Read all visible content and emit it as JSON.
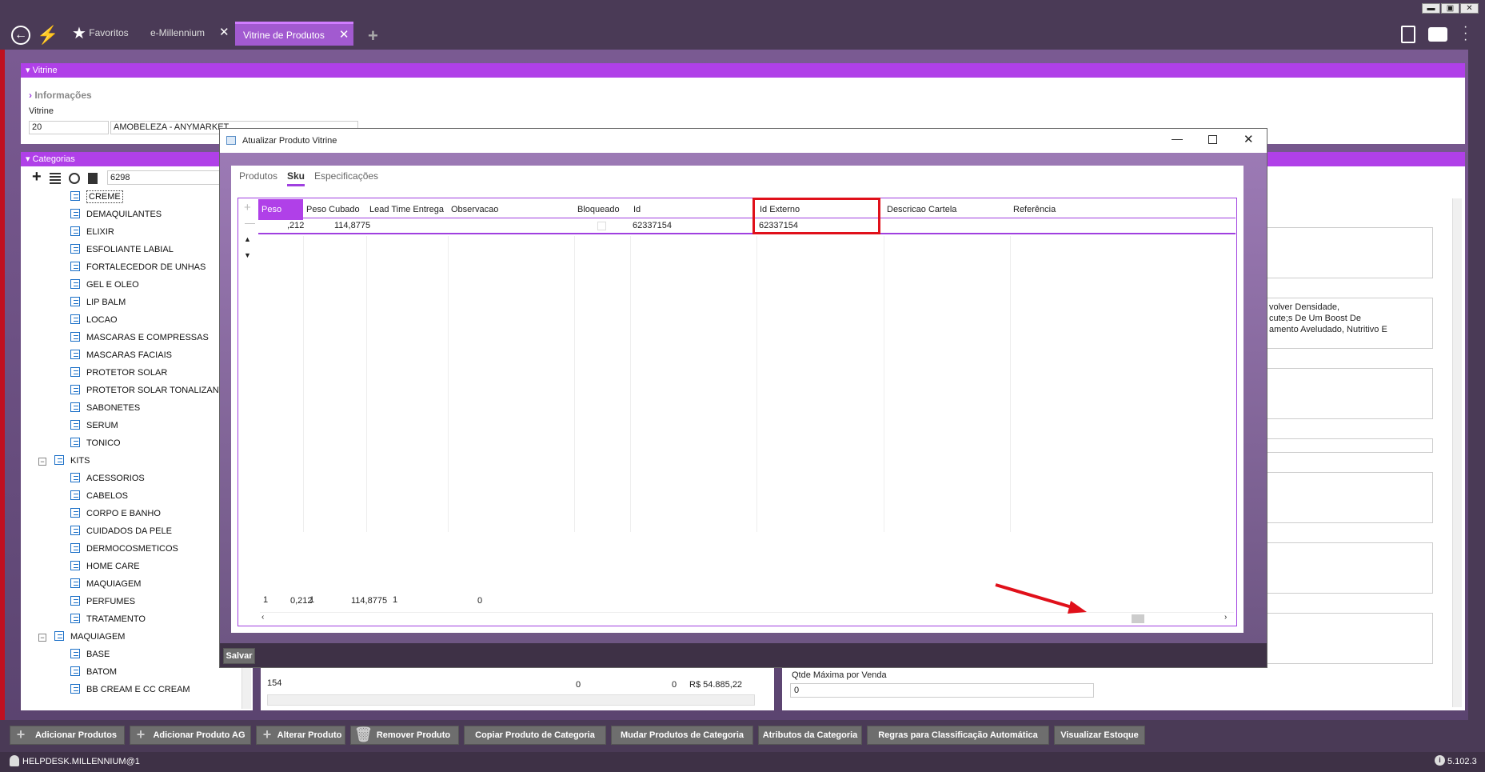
{
  "topbar": {
    "tabs": [
      {
        "label": "Favoritos"
      },
      {
        "label": "e-Millennium"
      },
      {
        "label": "Vitrine de Produtos"
      }
    ],
    "close_glyph": "✕",
    "add_glyph": "+",
    "win_min": "▬",
    "win_max": "▣",
    "win_close": "✕"
  },
  "vitrine": {
    "section_title": "Vitrine",
    "info_label": "Informações",
    "field_label": "Vitrine",
    "code": "20",
    "name": "AMOBELEZA - ANYMARKET"
  },
  "categorias": {
    "section_title": "Categorias",
    "search_value": "6298",
    "items": [
      {
        "label": "CREME",
        "level": 2,
        "selected": true
      },
      {
        "label": "DEMAQUILANTES",
        "level": 2
      },
      {
        "label": "ELIXIR",
        "level": 2
      },
      {
        "label": "ESFOLIANTE LABIAL",
        "level": 2
      },
      {
        "label": "FORTALECEDOR DE UNHAS",
        "level": 2
      },
      {
        "label": "GEL E OLEO",
        "level": 2
      },
      {
        "label": "LIP BALM",
        "level": 2
      },
      {
        "label": "LOCAO",
        "level": 2
      },
      {
        "label": "MASCARAS E COMPRESSAS",
        "level": 2
      },
      {
        "label": "MASCARAS FACIAIS",
        "level": 2
      },
      {
        "label": "PROTETOR SOLAR",
        "level": 2
      },
      {
        "label": "PROTETOR SOLAR TONALIZANTE",
        "level": 2
      },
      {
        "label": "SABONETES",
        "level": 2
      },
      {
        "label": "SERUM",
        "level": 2
      },
      {
        "label": "TONICO",
        "level": 2
      },
      {
        "label": "KITS",
        "level": 1
      },
      {
        "label": "ACESSORIOS",
        "level": 2
      },
      {
        "label": "CABELOS",
        "level": 2
      },
      {
        "label": "CORPO E BANHO",
        "level": 2
      },
      {
        "label": "CUIDADOS DA PELE",
        "level": 2
      },
      {
        "label": "DERMOCOSMETICOS",
        "level": 2
      },
      {
        "label": "HOME CARE",
        "level": 2
      },
      {
        "label": "MAQUIAGEM",
        "level": 2
      },
      {
        "label": "PERFUMES",
        "level": 2
      },
      {
        "label": "TRATAMENTO",
        "level": 2
      },
      {
        "label": "MAQUIAGEM",
        "level": 1
      },
      {
        "label": "BASE",
        "level": 2
      },
      {
        "label": "BATOM",
        "level": 2
      },
      {
        "label": "BB CREAM E CC CREAM",
        "level": 2
      }
    ]
  },
  "product_row": {
    "id": "154",
    "v1": "0",
    "v2": "0",
    "price": "R$ 54.885,22"
  },
  "right_panel": {
    "desc_lines": [
      "volver Densidade,",
      "cute;s De Um Boost De",
      "amento Aveludado, Nutritivo E"
    ],
    "qtde_label": "Qtde Máxima por Venda",
    "qtde_value": "0"
  },
  "modal": {
    "title": "Atualizar Produto Vitrine",
    "tabs": [
      "Produtos",
      "Sku",
      "Especificações"
    ],
    "active_tab": "Sku",
    "columns": [
      "Peso",
      "Peso Cubado",
      "Lead Time Entrega",
      "Observacao",
      "Bloqueado",
      "Id",
      "Id Externo",
      "Descricao Cartela",
      "Referência"
    ],
    "row": {
      "peso": ",212",
      "peso_cubado": "114,8775",
      "id": "62337154",
      "id_externo": "62337154"
    },
    "footer": {
      "count": "1",
      "peso_sum": "0,212",
      "c2": "1",
      "peso_cubado_sum": "114,8775",
      "c3": "1",
      "c4": "0"
    },
    "save_label": "Salvar"
  },
  "bottom_buttons": [
    "Adicionar Produtos",
    "Adicionar Produto AG",
    "Alterar Produto",
    "Remover Produto",
    "Copiar Produto de Categoria",
    "Mudar Produtos de Categoria",
    "Atributos da Categoria",
    "Regras para Classificação Automática",
    "Visualizar Estoque"
  ],
  "status": {
    "user": "HELPDESK.MILLENNIUM@1",
    "version": "5.102.3"
  },
  "colors": {
    "accent": "#b040e8",
    "frame": "#4a3a56",
    "highlight": "#e0101a"
  }
}
